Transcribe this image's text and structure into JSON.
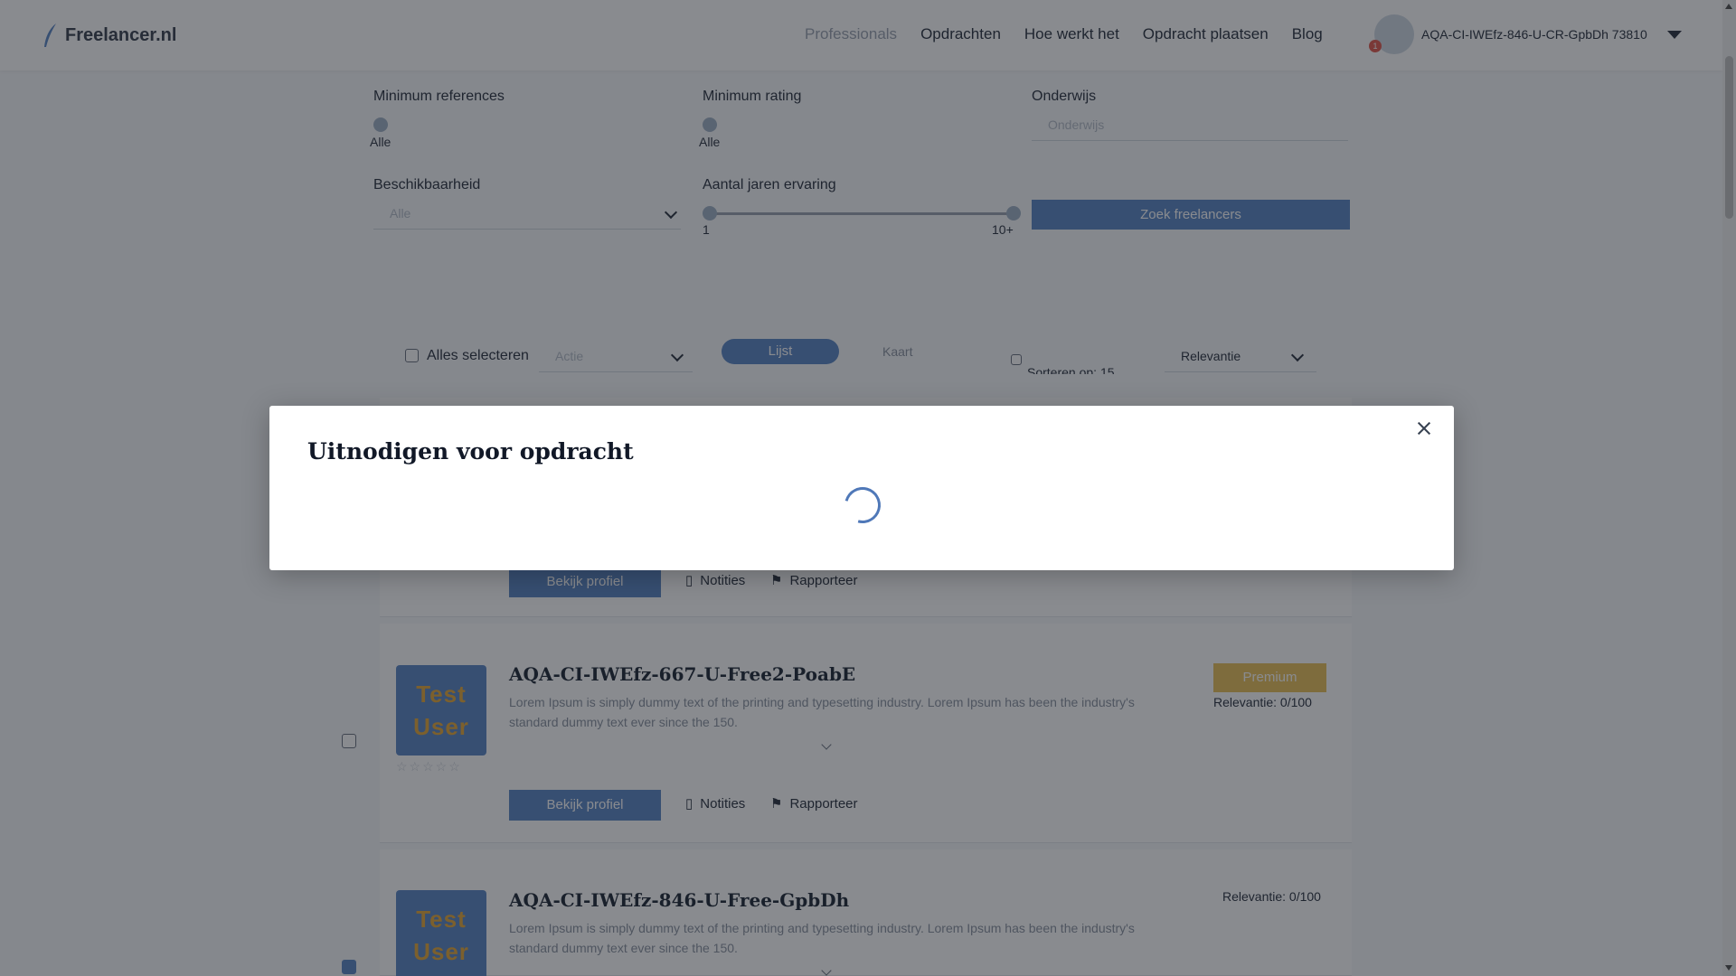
{
  "header": {
    "logo_text": "Freelancer.nl",
    "nav": [
      "Professionals",
      "Opdrachten",
      "Hoe werkt het",
      "Opdracht plaatsen",
      "Blog"
    ],
    "user_name": "AQA-CI-IWEfz-846-U-CR-GpbDh 73810",
    "notification_count": "1"
  },
  "filters": {
    "min_references_label": "Minimum references",
    "min_references_value": "Alle",
    "min_rating_label": "Minimum rating",
    "min_rating_value": "Alle",
    "education_label": "Onderwijs",
    "education_placeholder": "Onderwijs",
    "availability_label": "Beschikbaarheid",
    "availability_value": "Alle",
    "experience_label": "Aantal jaren ervaring",
    "experience_min": "1",
    "experience_max": "10+",
    "search_button": "Zoek freelancers"
  },
  "toolbar": {
    "select_all": "Alles selecteren",
    "action_placeholder": "Actie",
    "list_button": "Lijst",
    "map_button": "Kaart",
    "sort_label": "Sorteren op: 15",
    "sort_value": "Relevantie"
  },
  "cards": [
    {
      "view_profile": "Bekijk profiel",
      "notes": "Notities",
      "report": "Rapporteer"
    },
    {
      "thumb_line1": "Test",
      "thumb_line2": "User",
      "name": "AQA-CI-IWEfz-667-U-Free2-PoabE",
      "description": "Lorem Ipsum is simply dummy text of the printing and typesetting industry. Lorem Ipsum has been the industry's standard dummy text ever since the 150.",
      "premium": "Premium",
      "relevance": "Relevantie: 0/100",
      "view_profile": "Bekijk profiel",
      "notes": "Notities",
      "report": "Rapporteer",
      "stars": "☆☆☆☆☆"
    },
    {
      "thumb_line1": "Test",
      "thumb_line2": "User",
      "name": "AQA-CI-IWEfz-846-U-Free-GpbDh",
      "description": "Lorem Ipsum is simply dummy text of the printing and typesetting industry. Lorem Ipsum has been the industry's standard dummy text ever since the 150.",
      "relevance": "Relevantie: 0/100"
    }
  ],
  "modal": {
    "title": "Uitnodigen voor opdracht"
  },
  "colors": {
    "accent": "#5b86c5",
    "premium": "#e8c15a",
    "overlay": "rgba(20,24,32,0.50)"
  }
}
